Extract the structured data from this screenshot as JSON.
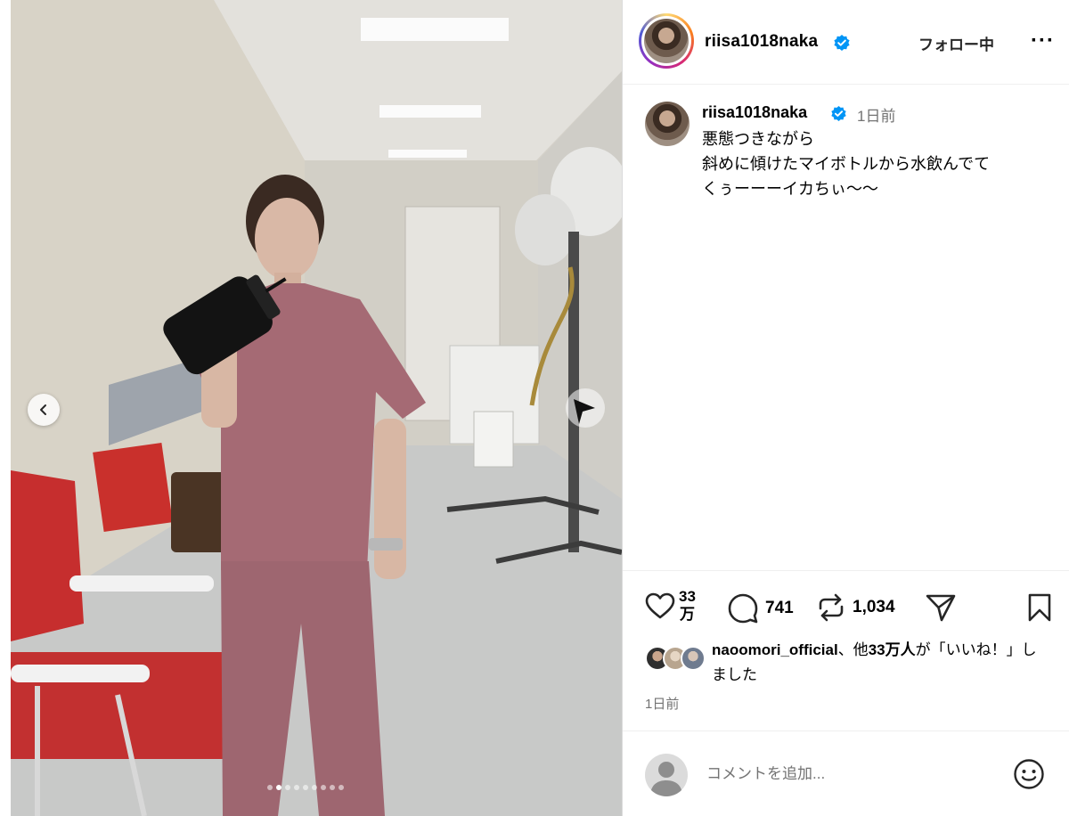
{
  "post": {
    "username": "riisa1018naka",
    "verified": true,
    "follow_label": "フォロー中",
    "more_label": "···",
    "caption_time": "1日前",
    "caption_lines": "悪態つきながら\n斜めに傾けたマイボトルから水飲んでて\nくぅーーーイカちぃ〜〜",
    "like_count_top": "33",
    "like_count_bottom": "万",
    "comment_count": "741",
    "repost_count": "1,034",
    "likes_user": "naoomori_official",
    "likes_text_mid": "、他",
    "likes_others": "33万人",
    "likes_text_end": "が「いいね！」しました",
    "post_time": "1日前",
    "comment_placeholder": "コメントを追加...",
    "carousel": {
      "total": 9,
      "active_index": 1
    }
  },
  "colors": {
    "verified": "#0095f6",
    "secondary_text": "#737373",
    "divider": "#dbdbdb"
  },
  "icons": [
    "verified-badge-icon",
    "heart-icon",
    "comment-icon",
    "repost-icon",
    "share-icon",
    "bookmark-icon",
    "emoji-icon",
    "chevron-left-icon"
  ]
}
